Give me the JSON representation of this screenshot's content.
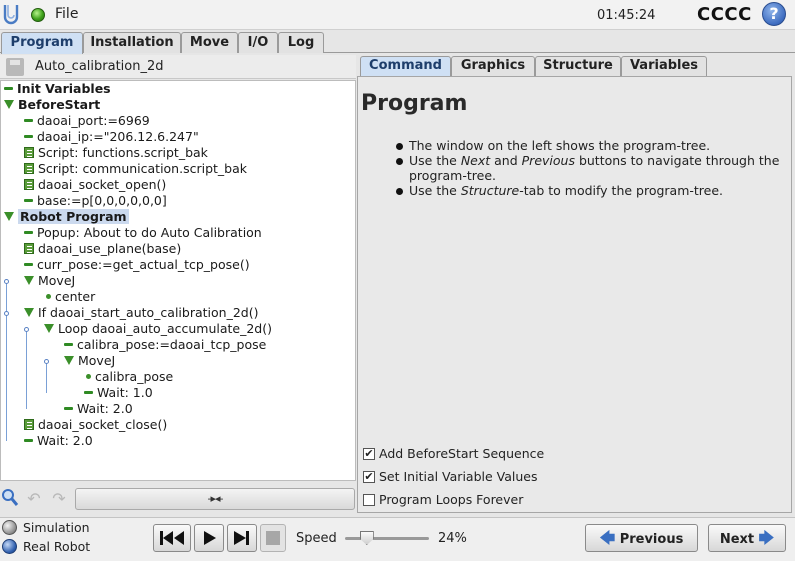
{
  "header": {
    "file_label": "File",
    "clock": "01:45:24",
    "robot_name": "CCCC",
    "help_glyph": "?"
  },
  "main_tabs": [
    "Program",
    "Installation",
    "Move",
    "I/O",
    "Log"
  ],
  "active_main_tab": "Program",
  "program": {
    "name": "Auto_calibration_2d"
  },
  "tree": [
    {
      "label": "Init Variables",
      "icon": "dash",
      "bold": true
    },
    {
      "label": "BeforeStart",
      "icon": "tri",
      "bold": true
    },
    {
      "label": "daoai_port:=6969",
      "icon": "dash"
    },
    {
      "label": "daoai_ip:=\"206.12.6.247\"",
      "icon": "dash"
    },
    {
      "label": "Script: functions.script_bak",
      "icon": "script"
    },
    {
      "label": "Script: communication.script_bak",
      "icon": "script"
    },
    {
      "label": "daoai_socket_open()",
      "icon": "script"
    },
    {
      "label": "base:=p[0,0,0,0,0,0]",
      "icon": "dash"
    },
    {
      "label": "Robot Program",
      "icon": "tri",
      "bold": true,
      "selected": true
    },
    {
      "label": "Popup: About to do Auto Calibration",
      "icon": "dash"
    },
    {
      "label": "daoai_use_plane(base)",
      "icon": "script"
    },
    {
      "label": "curr_pose:=get_actual_tcp_pose()",
      "icon": "dash"
    },
    {
      "label": "MoveJ",
      "icon": "tri"
    },
    {
      "label": "center",
      "icon": "point"
    },
    {
      "label": "If daoai_start_auto_calibration_2d()",
      "icon": "tri"
    },
    {
      "label": "Loop daoai_auto_accumulate_2d()",
      "icon": "tri"
    },
    {
      "label": "calibra_pose:=daoai_tcp_pose",
      "icon": "dash"
    },
    {
      "label": "MoveJ",
      "icon": "tri"
    },
    {
      "label": "calibra_pose",
      "icon": "point"
    },
    {
      "label": "Wait: 1.0",
      "icon": "dash"
    },
    {
      "label": "Wait: 2.0",
      "icon": "dash"
    },
    {
      "label": "daoai_socket_close()",
      "icon": "script"
    },
    {
      "label": "Wait: 2.0",
      "icon": "dash"
    }
  ],
  "tree_toolbar": {
    "collapse_glyph": "-▸◂-"
  },
  "right_tabs": [
    "Command",
    "Graphics",
    "Structure",
    "Variables"
  ],
  "active_right_tab": "Command",
  "command": {
    "title": "Program",
    "bullet1": "The window on the left shows the program-tree.",
    "bullet2_pre": "Use the ",
    "bullet2_next": "Next",
    "bullet2_mid": " and ",
    "bullet2_prev": "Previous",
    "bullet2_post": " buttons to navigate through the program-tree.",
    "bullet3_pre": "Use the ",
    "bullet3_em": "Structure",
    "bullet3_post": "-tab to modify the program-tree.",
    "options": [
      {
        "label": "Add BeforeStart Sequence",
        "checked": true
      },
      {
        "label": "Set Initial Variable Values",
        "checked": true
      },
      {
        "label": "Program Loops Forever",
        "checked": false
      }
    ]
  },
  "bottom": {
    "simulation_label": "Simulation",
    "real_robot_label": "Real Robot",
    "speed_label": "Speed",
    "speed_value": "24%",
    "speed_fraction": 0.24,
    "previous_label": "Previous",
    "next_label": "Next"
  },
  "colors": {
    "accent": "#3a6fc1",
    "tree_green": "#3b8f2a",
    "selection": "#cbd9ee"
  }
}
